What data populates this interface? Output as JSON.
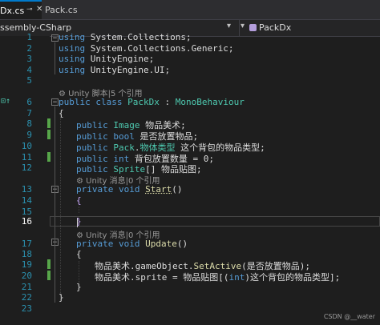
{
  "tabs": [
    {
      "label": "Dx.cs",
      "active": true
    },
    {
      "label": "Pack.cs",
      "active": false
    }
  ],
  "nav": {
    "left": "ssembly-CSharp",
    "right": "PackDx"
  },
  "gutter": {
    "lines": [
      "1",
      "2",
      "3",
      "4",
      "5",
      "6",
      "7",
      "8",
      "9",
      "10",
      "11",
      "12",
      "13",
      "14",
      "15",
      "16",
      "17",
      "18",
      "19",
      "20",
      "21",
      "22",
      "23"
    ]
  },
  "code": {
    "l1_kw": "using",
    "l1_rest": " System.Collections;",
    "l2_kw": "using",
    "l2_rest": " System.Collections.Generic;",
    "l3_kw": "using",
    "l3_rest": " UnityEngine;",
    "l4_kw": "using",
    "l4_rest": " UnityEngine.UI;",
    "lens1": "⚙ Unity 脚本|5 个引用",
    "l6_a": "public class ",
    "l6_b": "PackDx",
    "l6_c": " : ",
    "l6_d": "MonoBehaviour",
    "l7": "{",
    "l8_a": "public ",
    "l8_b": "Image",
    "l8_c": " 物品美术;",
    "l9_a": "public bool ",
    "l9_c": "是否放置物品;",
    "l10_a": "public ",
    "l10_b": "Pack",
    "l10_c": ".",
    "l10_d": "物体类型",
    "l10_e": " 这个背包的物品类型;",
    "l11_a": "public int ",
    "l11_c": "背包放置数量 = 0;",
    "l12_a": "public ",
    "l12_b": "Sprite",
    "l12_c": "[] 物品贴图;",
    "lens2": "⚙ Unity 消息|0 个引用",
    "l13_a": "private void ",
    "l13_b": "Start",
    "l13_c": "()",
    "l14": "{",
    "l16": "}",
    "lens3": "⚙ Unity 消息|0 个引用",
    "l17_a": "private void ",
    "l17_b": "Update",
    "l17_c": "()",
    "l18": "{",
    "l19_a": "物品美术.gameObject.",
    "l19_b": "SetActive",
    "l19_c": "(是否放置物品);",
    "l20_a": "物品美术.sprite = 物品贴图[(",
    "l20_b": "int",
    "l20_c": ")这个背包的物品类型];",
    "l21": "}",
    "l22": "}"
  },
  "watermark": "CSDN @__water",
  "colors": {
    "keyword": "#569cd6",
    "type": "#4ec9b0",
    "method": "#dcdcaa",
    "linenum": "#2b91af",
    "change": "#57a64a"
  }
}
